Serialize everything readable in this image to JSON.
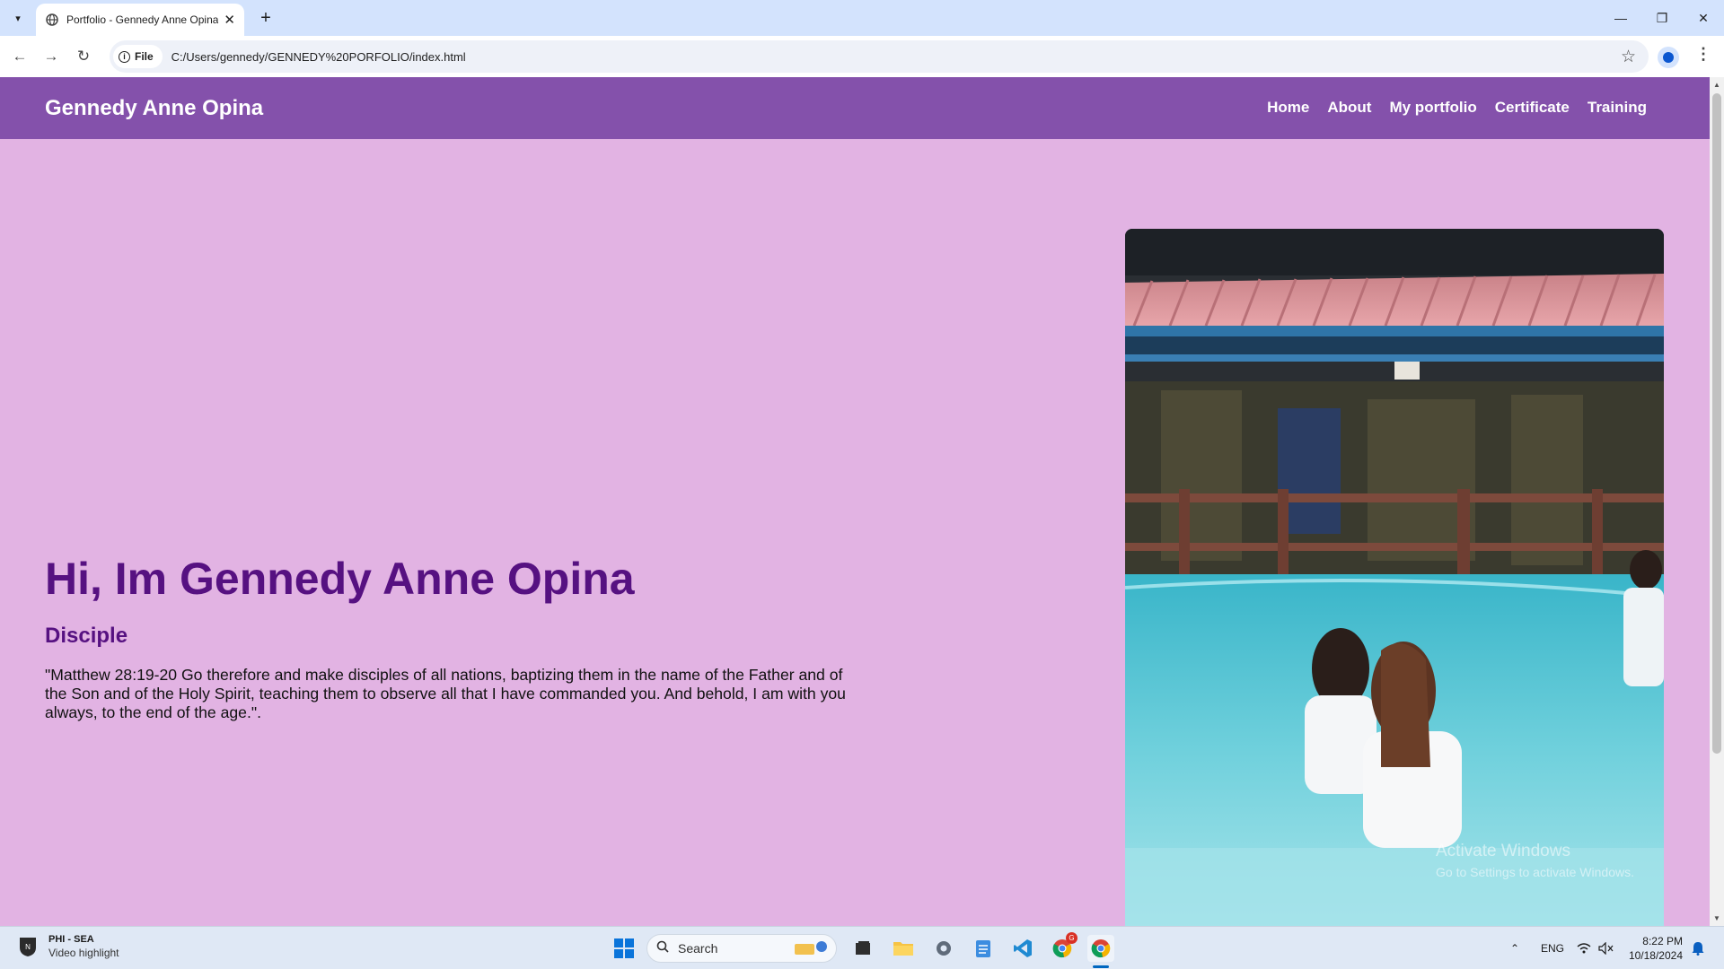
{
  "browser": {
    "tab_title": "Portfolio - Gennedy Anne Opina",
    "new_tab": "+",
    "site_chip": "File",
    "url": "C:/Users/gennedy/GENNEDY%20PORFOLIO/index.html"
  },
  "site": {
    "brand": "Gennedy Anne Opina",
    "nav": [
      "Home",
      "About",
      "My portfolio",
      "Certificate",
      "Training"
    ]
  },
  "hero": {
    "title": "Hi, Im Gennedy Anne Opina",
    "subtitle": "Disciple",
    "quote": "\"Matthew 28:19-20 Go therefore and make disciples of all nations, baptizing them in the name of the Father and of the Son and of the Holy Spirit, teaching them to observe all that I have commanded you. And behold, I am with you always, to the end of the age.\"."
  },
  "watermark": {
    "line1": "Activate Windows",
    "line2": "Go to Settings to activate Windows."
  },
  "taskbar": {
    "widget_title": "PHI - SEA",
    "widget_sub": "Video highlight",
    "search_label": "Search",
    "language": "ENG",
    "time": "8:22 PM",
    "date": "10/18/2024",
    "chrome_badge": "G"
  },
  "colors": {
    "page_bg": "#e2b3e3",
    "header_bg": "#8451ab",
    "heading": "#561181"
  }
}
